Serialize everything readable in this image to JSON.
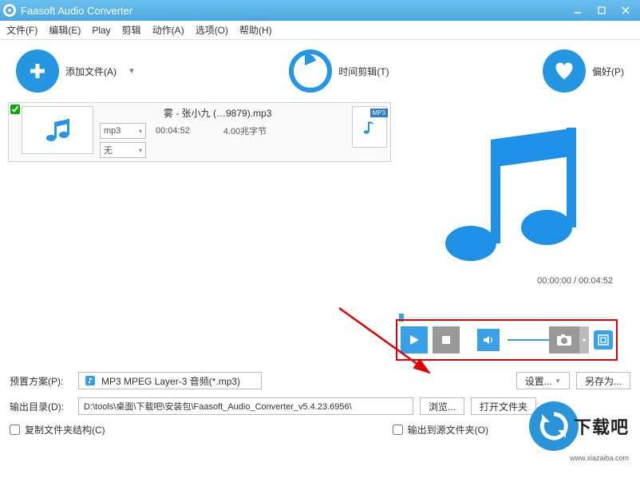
{
  "window": {
    "title": "Faasoft Audio Converter"
  },
  "menu": {
    "file": "文件(F)",
    "edit": "编辑(E)",
    "play": "Play",
    "clip": "剪辑",
    "action": "动作(A)",
    "options": "选项(O)",
    "help": "帮助(H)"
  },
  "toolbar": {
    "add_label": "添加文件(A)",
    "time_label": "时间剪辑(T)",
    "pref_label": "偏好(P)"
  },
  "file": {
    "name": "雾 - 张小九 (…9879).mp3",
    "format": "mp3",
    "duration": "00:04:52",
    "size": "4.00兆字节",
    "effect": "无",
    "type_badge": "MP3"
  },
  "preview": {
    "current": "00:00:00",
    "total": "00:04:52",
    "separator": " / "
  },
  "preset": {
    "label": "预置方案(P):",
    "value": "MP3 MPEG Layer-3 音频(*.mp3)",
    "settings_btn": "设置...",
    "saveas_btn": "另存为..."
  },
  "output": {
    "label": "输出目录(D):",
    "path": "D:\\tools\\桌面\\下载吧\\安装包\\Faasoft_Audio_Converter_v5.4.23.6956\\",
    "browse_btn": "浏览...",
    "open_btn": "打开文件夹"
  },
  "checks": {
    "copy_struct": "复制文件夹结构(C)",
    "output_to_src": "输出到源文件夹(O)"
  },
  "watermark": {
    "text": "下载吧",
    "url": "www.xiazaiba.com"
  }
}
